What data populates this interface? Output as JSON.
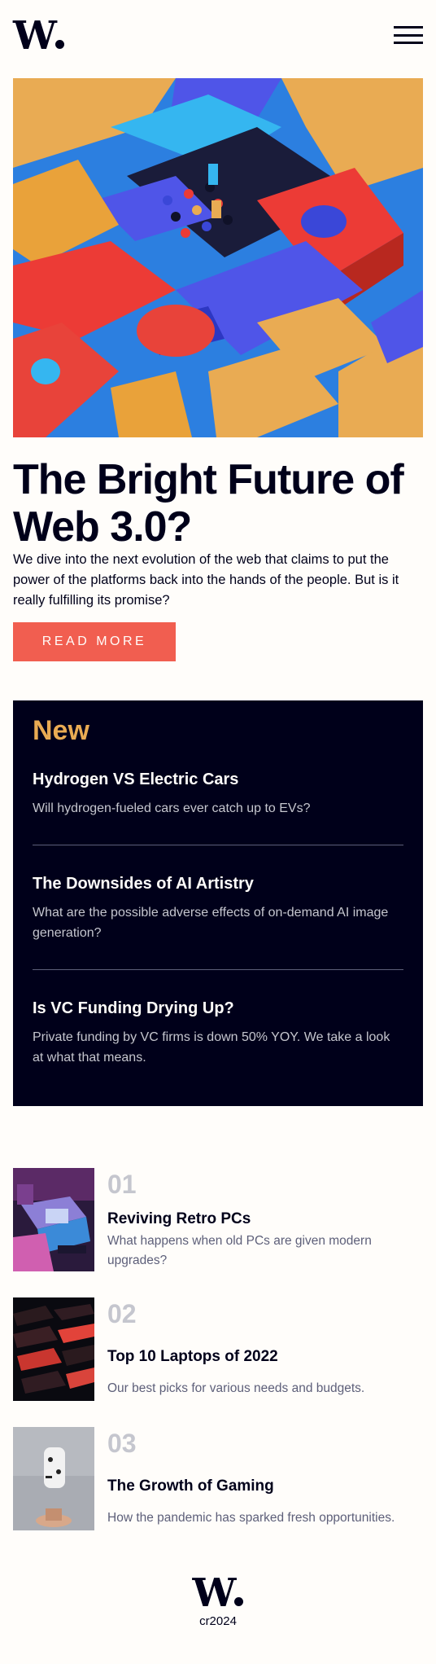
{
  "brand": {
    "logo_text": "W",
    "copyright": "cr2024"
  },
  "colors": {
    "accent": "#f15e50",
    "dark": "#00001a",
    "gold": "#e9ab53",
    "muted": "#5d5f79",
    "light_gray": "#c5c6ce"
  },
  "icons": {
    "menu": "hamburger-menu-icon"
  },
  "hero": {
    "title": "The Bright Future of Web 3.0?",
    "description": "We dive into the next evolution of the web that claims to put the power of the platforms back into the hands of the people. But is it really fulfilling its promise?",
    "cta_label": "READ MORE"
  },
  "new_section": {
    "heading": "New",
    "items": [
      {
        "title": "Hydrogen VS Electric Cars",
        "description": "Will hydrogen-fueled cars ever catch up to EVs?"
      },
      {
        "title": "The Downsides of AI Artistry",
        "description": "What are the possible adverse effects of on-demand AI image generation?"
      },
      {
        "title": "Is VC Funding Drying Up?",
        "description": "Private funding by VC firms is down 50% YOY. We take a look at what that means."
      }
    ]
  },
  "articles": [
    {
      "number": "01",
      "title": "Reviving Retro PCs",
      "description": "What happens when old PCs are given modern upgrades?"
    },
    {
      "number": "02",
      "title": "Top 10 Laptops of 2022",
      "description": "Our best picks for various needs and budgets."
    },
    {
      "number": "03",
      "title": "The Growth of Gaming",
      "description": "How the pandemic has sparked fresh opportunities."
    }
  ]
}
